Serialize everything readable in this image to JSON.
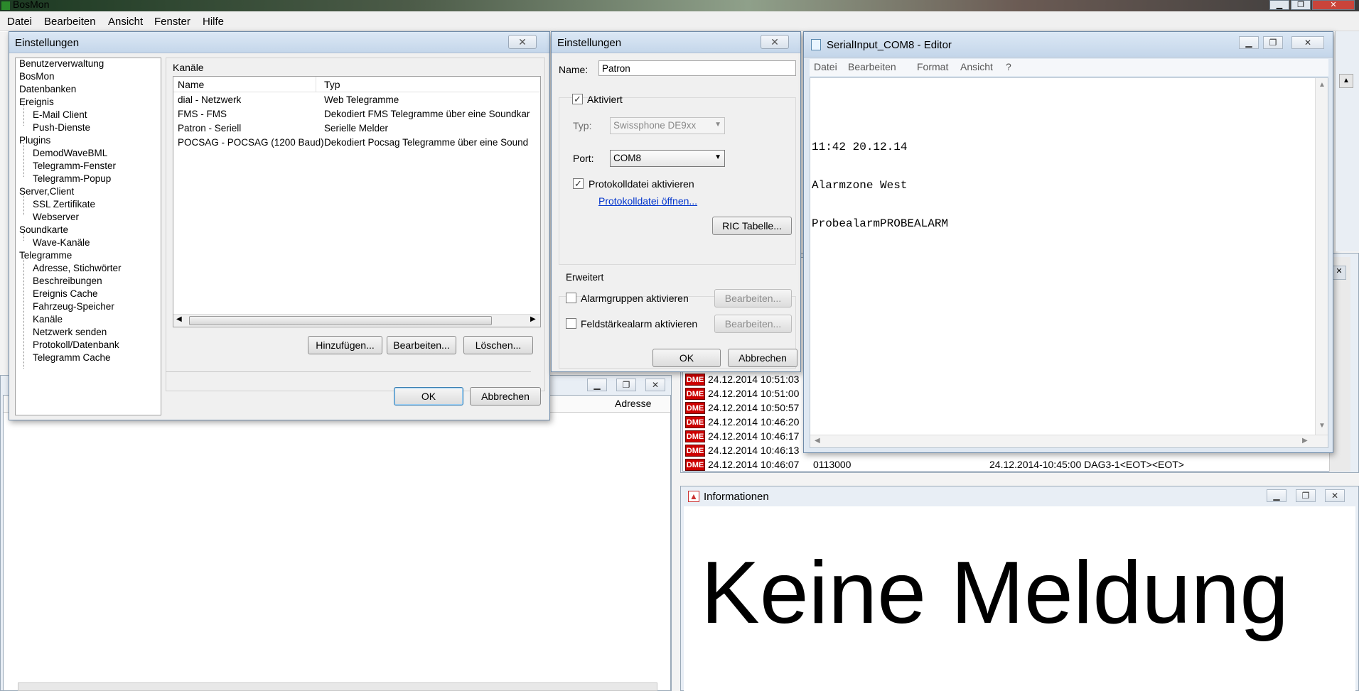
{
  "app": {
    "title": "BosMon"
  },
  "menu": [
    "Datei",
    "Bearbeiten",
    "Ansicht",
    "Fenster",
    "Hilfe"
  ],
  "settings_dialog": {
    "title": "Einstellungen",
    "tree": [
      {
        "label": "Benutzerverwaltung",
        "level": 0
      },
      {
        "label": "BosMon",
        "level": 0
      },
      {
        "label": "Datenbanken",
        "level": 0
      },
      {
        "label": "Ereignis",
        "level": 0
      },
      {
        "label": "E-Mail Client",
        "level": 1
      },
      {
        "label": "Push-Dienste",
        "level": 1
      },
      {
        "label": "Plugins",
        "level": 0
      },
      {
        "label": "DemodWaveBML",
        "level": 1
      },
      {
        "label": "Telegramm-Fenster",
        "level": 1
      },
      {
        "label": "Telegramm-Popup",
        "level": 1
      },
      {
        "label": "Server,Client",
        "level": 0
      },
      {
        "label": "SSL Zertifikate",
        "level": 1
      },
      {
        "label": "Webserver",
        "level": 1
      },
      {
        "label": "Soundkarte",
        "level": 0
      },
      {
        "label": "Wave-Kanäle",
        "level": 1
      },
      {
        "label": "Telegramme",
        "level": 0
      },
      {
        "label": "Adresse, Stichwörter",
        "level": 1
      },
      {
        "label": "Beschreibungen",
        "level": 1
      },
      {
        "label": "Ereignis Cache",
        "level": 1
      },
      {
        "label": "Fahrzeug-Speicher",
        "level": 1
      },
      {
        "label": "Kanäle",
        "level": 1
      },
      {
        "label": "Netzwerk senden",
        "level": 1
      },
      {
        "label": "Protokoll/Datenbank",
        "level": 1
      },
      {
        "label": "Telegramm Cache",
        "level": 1
      }
    ],
    "group_title": "Kanäle",
    "columns": [
      "Name",
      "Typ"
    ],
    "rows": [
      [
        "dial - Netzwerk",
        "Web Telegramme"
      ],
      [
        "FMS - FMS",
        "Dekodiert FMS Telegramme über eine Soundkar"
      ],
      [
        "Patron - Seriell",
        "Serielle Melder"
      ],
      [
        "POCSAG - POCSAG (1200 Baud)",
        "Dekodiert Pocsag Telegramme über eine Sound"
      ]
    ],
    "buttons": {
      "add": "Hinzufügen...",
      "edit": "Bearbeiten...",
      "delete": "Löschen...",
      "ok": "OK",
      "cancel": "Abbrechen"
    }
  },
  "channel_dialog": {
    "title": "Einstellungen",
    "name_label": "Name:",
    "name_value": "Patron",
    "activated_label": "Aktiviert",
    "type_label": "Typ:",
    "type_value": "Swissphone DE9xx",
    "port_label": "Port:",
    "port_value": "COM8",
    "log_label": "Protokolldatei aktivieren",
    "log_link": "Protokolldatei öffnen...",
    "ric_button": "RIC Tabelle...",
    "advanced_title": "Erweitert",
    "alarm_groups_label": "Alarmgruppen aktivieren",
    "field_alarm_label": "Feldstärkealarm aktivieren",
    "edit_label": "Bearbeiten...",
    "ok": "OK",
    "cancel": "Abbrechen"
  },
  "editor": {
    "title": "SerialInput_COM8 - Editor",
    "menu": [
      "Datei",
      "Bearbeiten",
      "Format",
      "Ansicht",
      "?"
    ],
    "lines": [
      "11:42 20.12.14",
      "Alarmzone West",
      "ProbealarmPROBEALARM"
    ]
  },
  "telegram_log": {
    "column_address": "Adresse",
    "badge": "DME",
    "rows": [
      "24.12.2014 10:51:03",
      "24.12.2014 10:51:00",
      "24.12.2014 10:50:57",
      "24.12.2014 10:46:20",
      "24.12.2014 10:46:17",
      "24.12.2014 10:46:13",
      "24.12.2014 10:46:07"
    ],
    "last_address": "0113000",
    "last_text": "24.12.2014-10:45:00 DAG3-1<EOT><EOT>"
  },
  "info_window": {
    "title": "Informationen",
    "message": "Keine Meldung"
  }
}
